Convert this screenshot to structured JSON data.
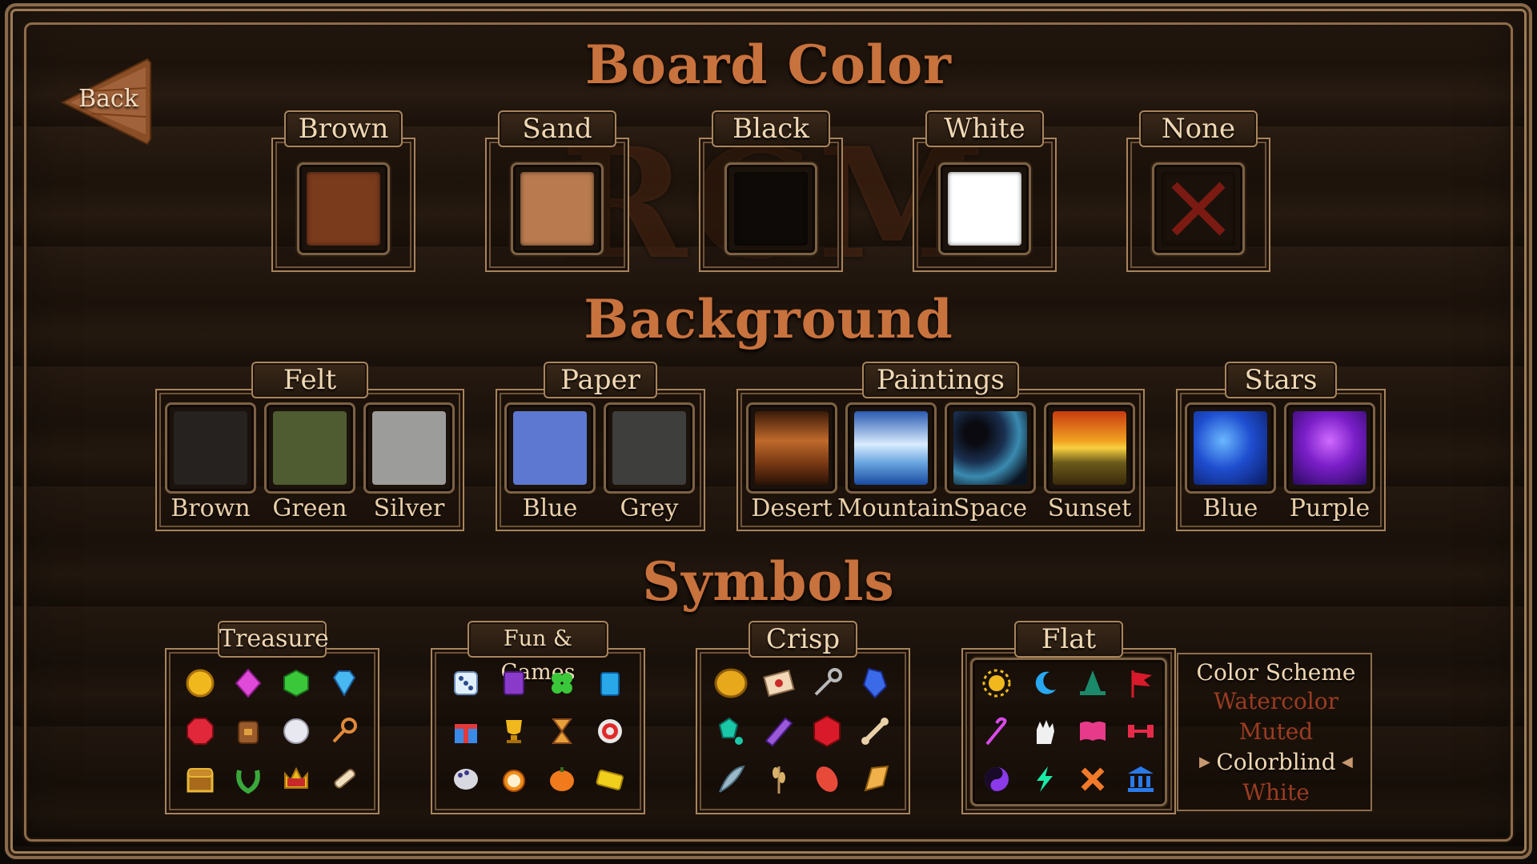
{
  "back_label": "Back",
  "watermark": "RCM",
  "board_color": {
    "title": "Board Color",
    "options": [
      {
        "label": "Brown",
        "color": "#7a3a1c"
      },
      {
        "label": "Sand",
        "color": "#b87a4e"
      },
      {
        "label": "Black",
        "color": "#0e0a07"
      },
      {
        "label": "White",
        "color": "#ffffff"
      },
      {
        "label": "None",
        "color": "#1a110a"
      }
    ]
  },
  "background": {
    "title": "Background",
    "groups": [
      {
        "label": "Felt",
        "items": [
          {
            "label": "Brown",
            "color": "#262220"
          },
          {
            "label": "Green",
            "color": "#4f5b30"
          },
          {
            "label": "Silver",
            "color": "#9c9c9a"
          }
        ]
      },
      {
        "label": "Paper",
        "items": [
          {
            "label": "Blue",
            "color": "#5d78d0"
          },
          {
            "label": "Grey",
            "color": "#3e3e3c"
          }
        ]
      },
      {
        "label": "Paintings",
        "items": [
          {
            "label": "Desert",
            "color": "#8a4a1c"
          },
          {
            "label": "Mountain",
            "color": "#3e7ac8"
          },
          {
            "label": "Space",
            "color": "#10233a"
          },
          {
            "label": "Sunset",
            "color": "#d8741c"
          }
        ]
      },
      {
        "label": "Stars",
        "items": [
          {
            "label": "Blue",
            "color": "#1f4ed0"
          },
          {
            "label": "Purple",
            "color": "#7a1ec8"
          }
        ]
      }
    ]
  },
  "symbols": {
    "title": "Symbols",
    "sets": [
      {
        "label": "Treasure"
      },
      {
        "label": "Fun & Games"
      },
      {
        "label": "Crisp"
      },
      {
        "label": "Flat"
      }
    ]
  },
  "color_scheme": {
    "title": "Color Scheme",
    "options": [
      "Watercolor",
      "Muted",
      "Colorblind",
      "White"
    ],
    "selected": "Colorblind"
  },
  "colors": {
    "title": "#c8723e",
    "frame": "#a8845c",
    "text": "#f0d8b4",
    "unselected_option": "#9a3c22"
  }
}
